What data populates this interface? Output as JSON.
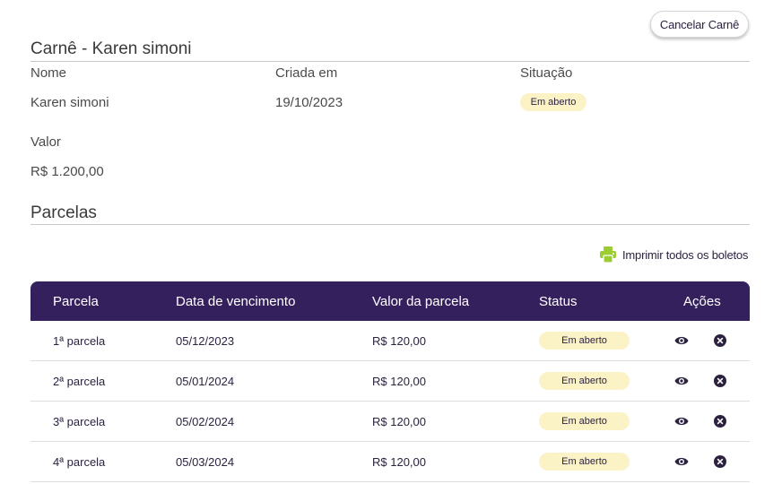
{
  "header": {
    "cancel_label": "Cancelar Carnê"
  },
  "carne": {
    "title": "Carnê - Karen simoni",
    "name_label": "Nome",
    "name_value": "Karen simoni",
    "created_label": "Criada em",
    "created_value": "19/10/2023",
    "status_label": "Situação",
    "status_value": "Em aberto",
    "amount_label": "Valor",
    "amount_value": "R$ 1.200,00"
  },
  "parcelas": {
    "title": "Parcelas",
    "print_all_label": "Imprimir todos os boletos",
    "columns": [
      "Parcela",
      "Data de vencimento",
      "Valor da parcela",
      "Status",
      "Ações"
    ],
    "rows": [
      {
        "parcela": "1ª parcela",
        "vencimento": "05/12/2023",
        "valor": "R$ 120,00",
        "status": "Em aberto"
      },
      {
        "parcela": "2ª parcela",
        "vencimento": "05/01/2024",
        "valor": "R$ 120,00",
        "status": "Em aberto"
      },
      {
        "parcela": "3ª parcela",
        "vencimento": "05/02/2024",
        "valor": "R$ 120,00",
        "status": "Em aberto"
      },
      {
        "parcela": "4ª parcela",
        "vencimento": "05/03/2024",
        "valor": "R$ 120,00",
        "status": "Em aberto"
      }
    ]
  },
  "colors": {
    "header_bg": "#35205e",
    "badge_bg": "#fbf3c6",
    "print_icon": "#9acd32",
    "text_dark": "#2c2240"
  },
  "icons": {
    "print": "printer-icon",
    "view": "eye-icon",
    "cancel": "close-circle-icon"
  }
}
